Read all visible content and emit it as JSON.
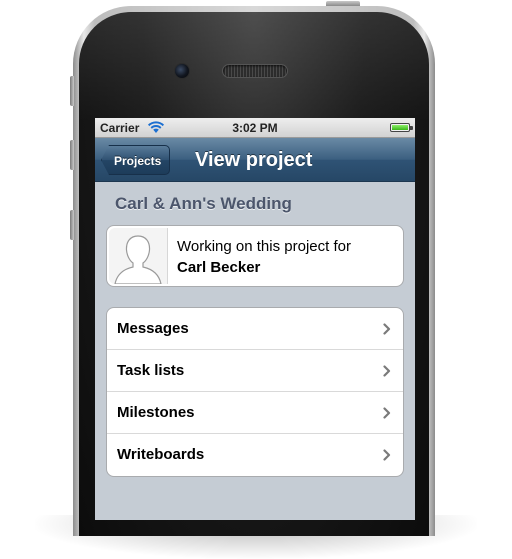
{
  "status_bar": {
    "carrier": "Carrier",
    "time": "3:02 PM",
    "wifi_icon": "wifi-icon",
    "battery_icon": "battery-icon"
  },
  "nav_bar": {
    "back_label": "Projects",
    "title": "View project"
  },
  "project": {
    "name": "Carl & Ann's Wedding",
    "owner_intro": "Working on this project for",
    "owner_name": "Carl Becker",
    "avatar_icon": "person-silhouette-icon"
  },
  "menu": {
    "items": [
      {
        "label": "Messages",
        "icon": "chevron-right-icon"
      },
      {
        "label": "Task lists",
        "icon": "chevron-right-icon"
      },
      {
        "label": "Milestones",
        "icon": "chevron-right-icon"
      },
      {
        "label": "Writeboards",
        "icon": "chevron-right-icon"
      }
    ]
  },
  "colors": {
    "nav_bar": "#3b5f80",
    "background": "#c5ccd4",
    "project_title": "#4c566c"
  }
}
